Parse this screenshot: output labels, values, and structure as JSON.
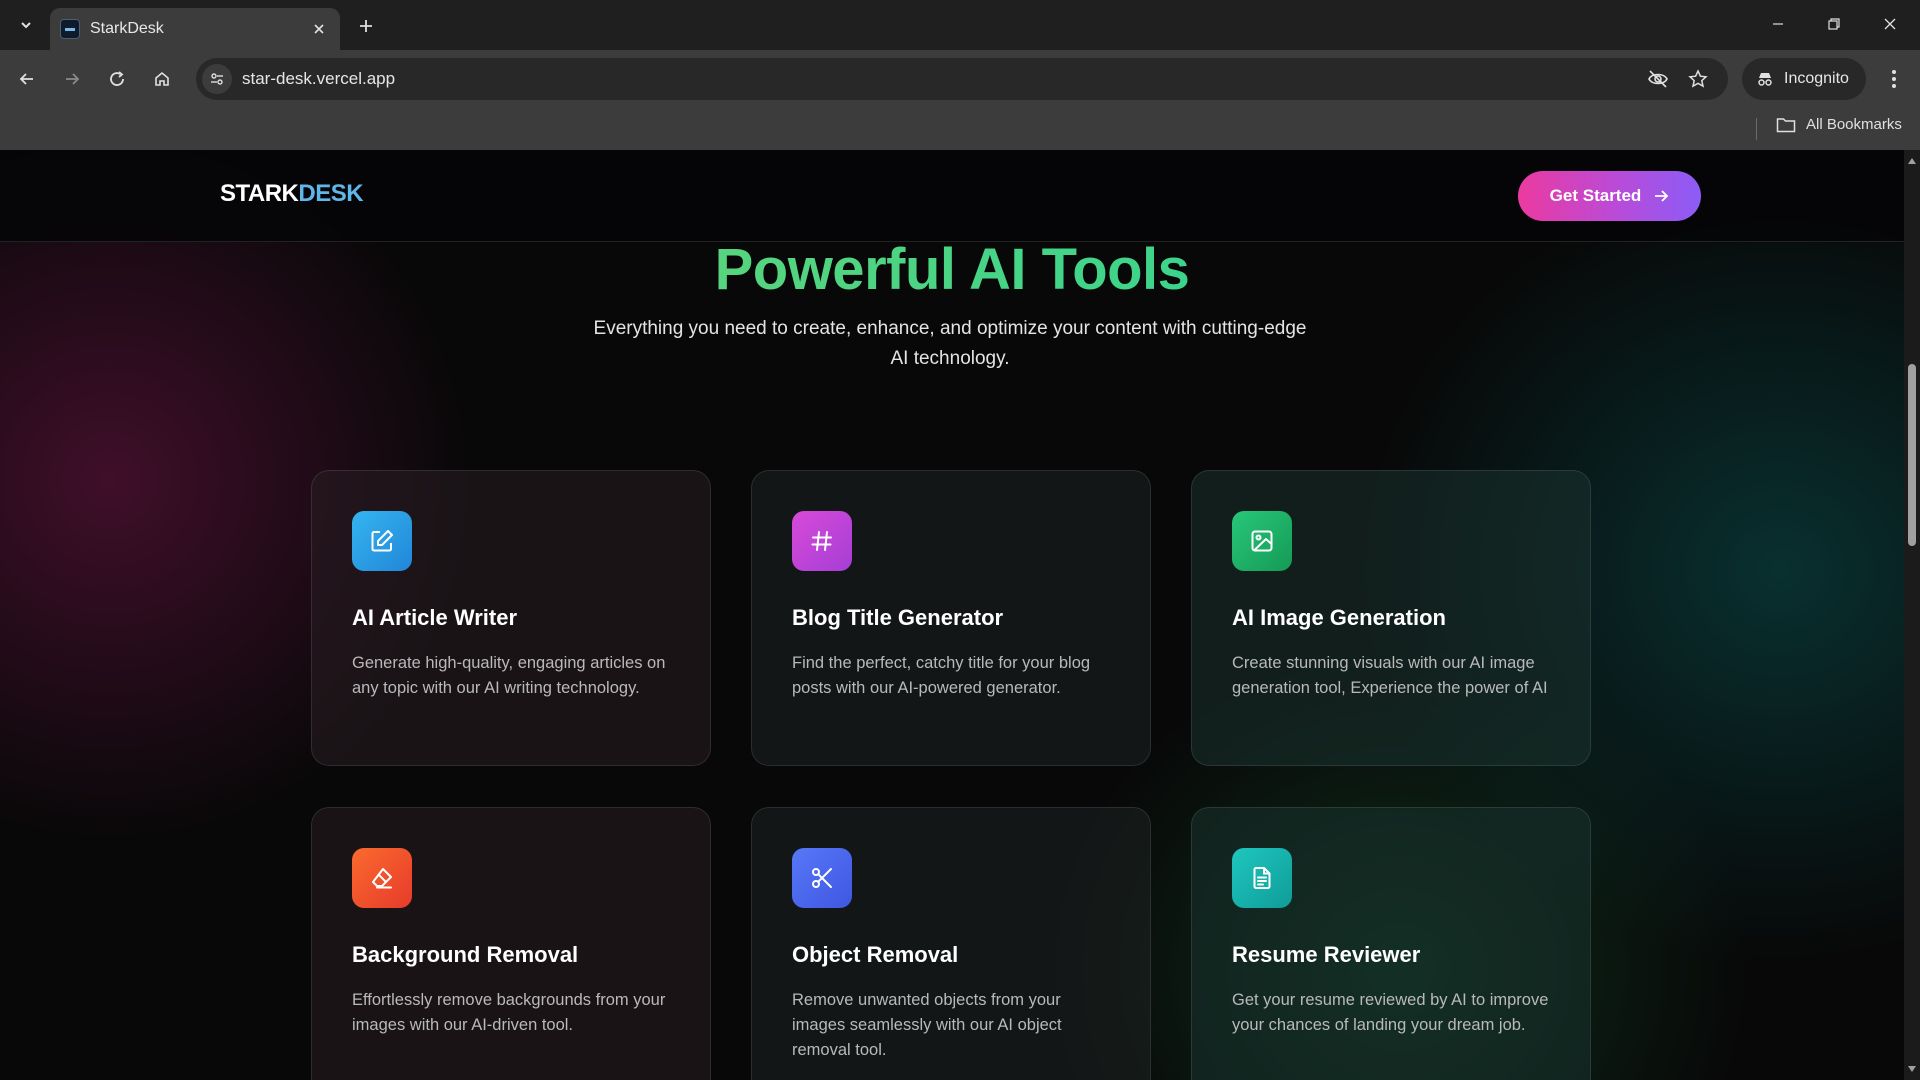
{
  "browser": {
    "tab_title": "StarkDesk",
    "url": "star-desk.vercel.app",
    "incognito_label": "Incognito",
    "bookmarks_label": "All Bookmarks"
  },
  "site": {
    "logo_part1": "STARK",
    "logo_part2": "DESK",
    "cta_label": "Get Started"
  },
  "hero": {
    "title": "Powerful AI Tools",
    "subtitle": "Everything you need to create, enhance, and optimize your content with cutting-edge AI technology."
  },
  "tools": [
    {
      "title": "AI Article Writer",
      "description": "Generate high-quality, engaging articles on any topic with our AI writing technology.",
      "icon": "edit-icon",
      "color": "#2aa9e8"
    },
    {
      "title": "Blog Title Generator",
      "description": "Find the perfect, catchy title for your blog posts with our AI-powered generator.",
      "icon": "hash-icon",
      "color": "#c744d6"
    },
    {
      "title": "AI Image Generation",
      "description": "Create stunning visuals with our AI image generation tool, Experience the power of AI",
      "icon": "image-icon",
      "color": "#22b86a"
    },
    {
      "title": "Background Removal",
      "description": "Effortlessly remove backgrounds from your images with our AI-driven tool.",
      "icon": "eraser-icon",
      "color": "#f0552a"
    },
    {
      "title": "Object Removal",
      "description": "Remove unwanted objects from your images seamlessly with our AI object removal tool.",
      "icon": "scissors-icon",
      "color": "#4a6cf0"
    },
    {
      "title": "Resume Reviewer",
      "description": "Get your resume reviewed by AI to improve your chances of landing your dream job.",
      "icon": "document-icon",
      "color": "#18b8b0"
    }
  ]
}
